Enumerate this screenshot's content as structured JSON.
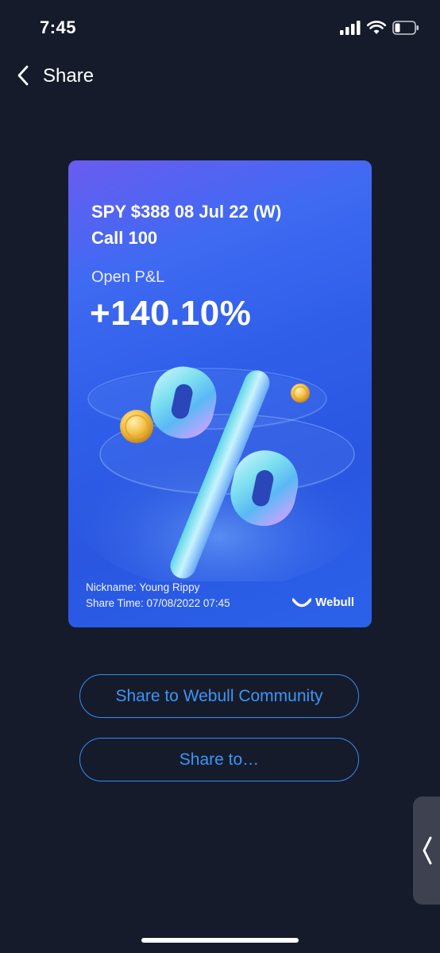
{
  "status_bar": {
    "time": "7:45",
    "icons": [
      "signal-icon",
      "wifi-icon",
      "battery-icon"
    ]
  },
  "nav": {
    "back_icon": "chevron-left-icon",
    "title": "Share"
  },
  "card": {
    "title_line1": "SPY $388 08 Jul 22 (W)",
    "title_line2": "Call 100",
    "pl_label": "Open P&L",
    "pl_value": "+140.10%",
    "nickname": "Nickname: Young Rippy",
    "share_time": "Share Time: 07/08/2022 07:45",
    "brand": "Webull",
    "illustration": "percent-sign-with-coins"
  },
  "actions": {
    "community_label": "Share to Webull Community",
    "share_label": "Share to…"
  },
  "colors": {
    "background": "#151b2b",
    "accent": "#2f8df2",
    "card_gradient_start": "#6a5cf0",
    "card_gradient_end": "#2a56e0"
  }
}
